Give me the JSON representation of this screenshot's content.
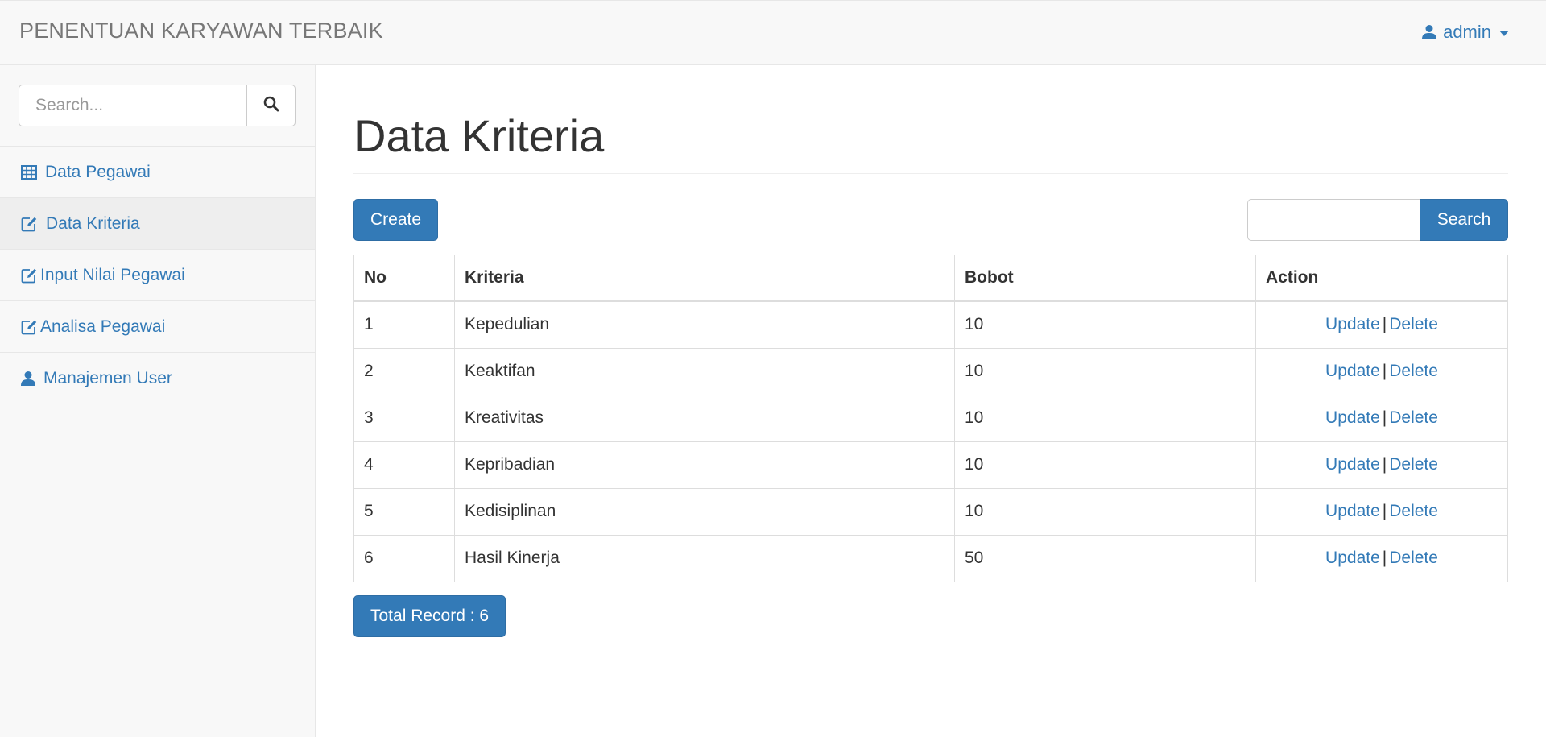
{
  "navbar": {
    "brand": "PENENTUAN KARYAWAN TERBAIK",
    "user_icon": "user-icon",
    "user_label": "admin",
    "user_caret_icon": "caret-down-icon"
  },
  "sidebar": {
    "search_placeholder": "Search...",
    "search_icon": "search-icon",
    "items": [
      {
        "label": "Data Pegawai",
        "icon": "table-icon"
      },
      {
        "label": "Data Kriteria",
        "icon": "edit-icon",
        "active": true
      },
      {
        "label": "Input Nilai Pegawai",
        "icon": "edit-icon"
      },
      {
        "label": "Analisa Pegawai",
        "icon": "edit-icon"
      },
      {
        "label": "Manajemen User",
        "icon": "user-icon"
      }
    ]
  },
  "main": {
    "title": "Data Kriteria",
    "create_label": "Create",
    "search_value": "",
    "search_button_label": "Search",
    "table": {
      "headers": [
        "No",
        "Kriteria",
        "Bobot",
        "Action"
      ],
      "rows": [
        {
          "no": "1",
          "kriteria": "Kepedulian",
          "bobot": "10"
        },
        {
          "no": "2",
          "kriteria": "Keaktifan",
          "bobot": "10"
        },
        {
          "no": "3",
          "kriteria": "Kreativitas",
          "bobot": "10"
        },
        {
          "no": "4",
          "kriteria": "Kepribadian",
          "bobot": "10"
        },
        {
          "no": "5",
          "kriteria": "Kedisiplinan",
          "bobot": "10"
        },
        {
          "no": "6",
          "kriteria": "Hasil Kinerja",
          "bobot": "50"
        }
      ],
      "update_label": "Update",
      "separator": "|",
      "delete_label": "Delete"
    },
    "total_record_label": "Total Record : 6"
  },
  "colors": {
    "primary": "#337ab7",
    "navbar_bg": "#f8f8f8",
    "active_item_bg": "#eeeeee"
  }
}
